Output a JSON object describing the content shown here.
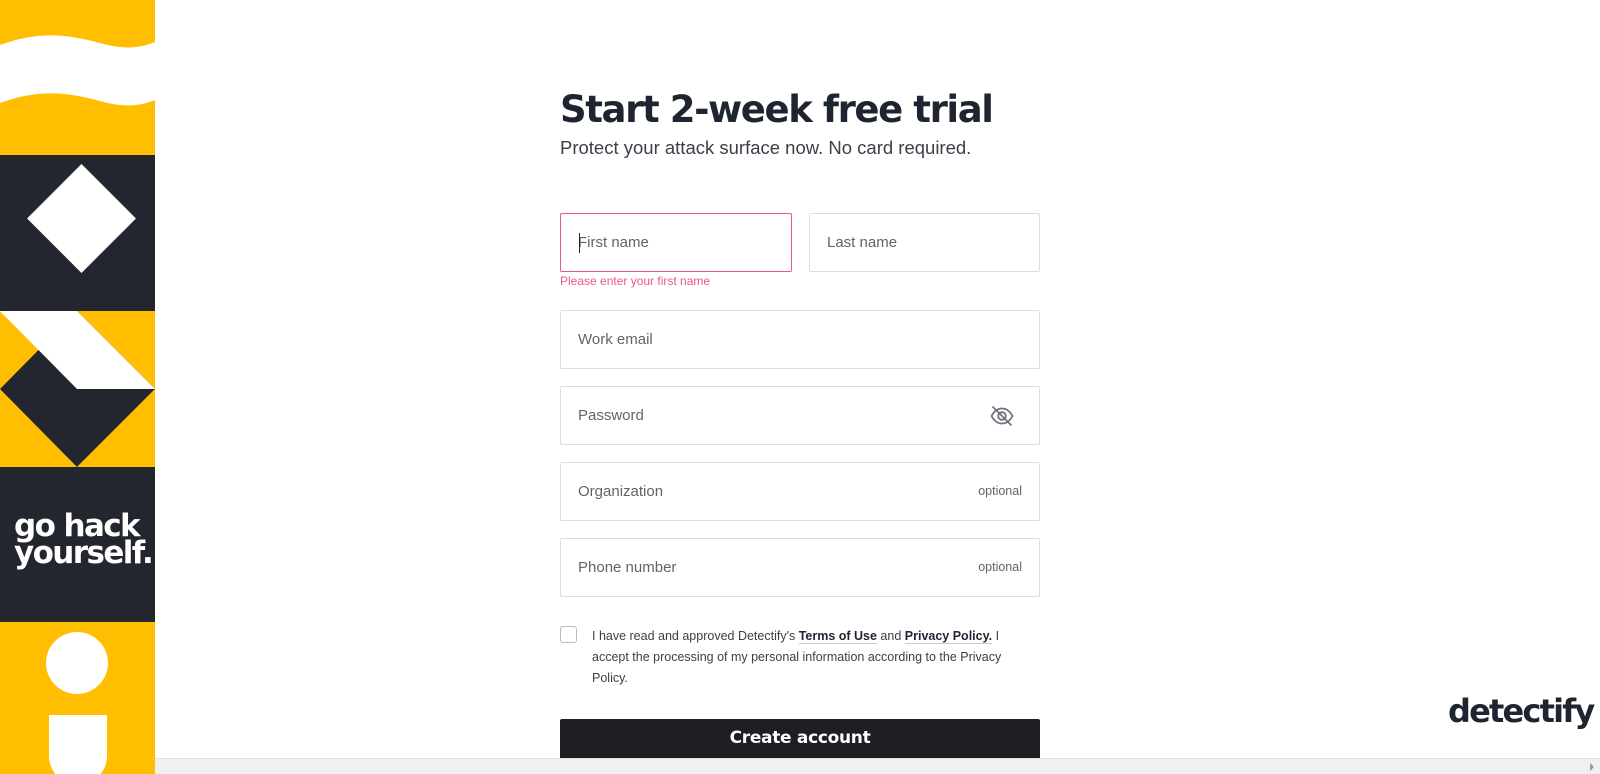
{
  "colors": {
    "brand_yellow": "#ffbe00",
    "brand_dark": "#24262f",
    "error_pink": "#e8578d",
    "button_dark": "#1d1f22"
  },
  "sidebar": {
    "slogan_line1": "go hack",
    "slogan_line2": "yourself."
  },
  "form": {
    "title": "Start 2-week free trial",
    "subtitle": "Protect your attack surface now. No card required.",
    "first_name": {
      "placeholder": "First name",
      "value": "",
      "error": "Please enter your first name"
    },
    "last_name": {
      "placeholder": "Last name",
      "value": ""
    },
    "email": {
      "placeholder": "Work email",
      "value": ""
    },
    "password": {
      "placeholder": "Password",
      "value": "",
      "toggle_icon": "eye-slash-icon"
    },
    "organization": {
      "placeholder": "Organization",
      "value": "",
      "optional_label": "optional"
    },
    "phone": {
      "placeholder": "Phone number",
      "value": "",
      "optional_label": "optional"
    },
    "consent": {
      "checked": false,
      "text_1": "I have read and approved Detectify's ",
      "terms_link": "Terms of Use",
      "text_2": " and ",
      "privacy_link": "Privacy Policy.",
      "text_3": " I accept the processing of my personal information according to the Privacy Policy."
    },
    "submit_label": "Create account"
  },
  "brand": {
    "logo_text": "detectify"
  }
}
